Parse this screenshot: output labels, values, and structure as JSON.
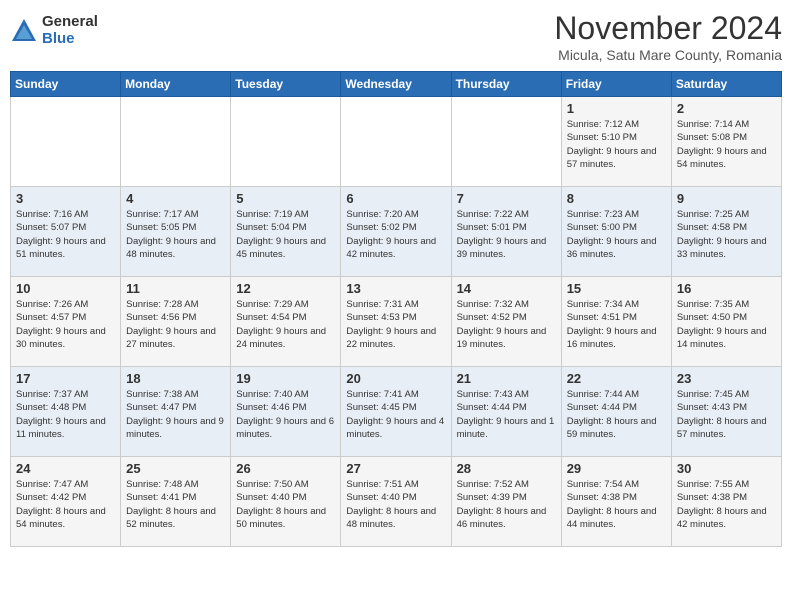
{
  "logo": {
    "general": "General",
    "blue": "Blue"
  },
  "header": {
    "month": "November 2024",
    "location": "Micula, Satu Mare County, Romania"
  },
  "weekdays": [
    "Sunday",
    "Monday",
    "Tuesday",
    "Wednesday",
    "Thursday",
    "Friday",
    "Saturday"
  ],
  "weeks": [
    [
      {
        "day": "",
        "info": ""
      },
      {
        "day": "",
        "info": ""
      },
      {
        "day": "",
        "info": ""
      },
      {
        "day": "",
        "info": ""
      },
      {
        "day": "",
        "info": ""
      },
      {
        "day": "1",
        "info": "Sunrise: 7:12 AM\nSunset: 5:10 PM\nDaylight: 9 hours and 57 minutes."
      },
      {
        "day": "2",
        "info": "Sunrise: 7:14 AM\nSunset: 5:08 PM\nDaylight: 9 hours and 54 minutes."
      }
    ],
    [
      {
        "day": "3",
        "info": "Sunrise: 7:16 AM\nSunset: 5:07 PM\nDaylight: 9 hours and 51 minutes."
      },
      {
        "day": "4",
        "info": "Sunrise: 7:17 AM\nSunset: 5:05 PM\nDaylight: 9 hours and 48 minutes."
      },
      {
        "day": "5",
        "info": "Sunrise: 7:19 AM\nSunset: 5:04 PM\nDaylight: 9 hours and 45 minutes."
      },
      {
        "day": "6",
        "info": "Sunrise: 7:20 AM\nSunset: 5:02 PM\nDaylight: 9 hours and 42 minutes."
      },
      {
        "day": "7",
        "info": "Sunrise: 7:22 AM\nSunset: 5:01 PM\nDaylight: 9 hours and 39 minutes."
      },
      {
        "day": "8",
        "info": "Sunrise: 7:23 AM\nSunset: 5:00 PM\nDaylight: 9 hours and 36 minutes."
      },
      {
        "day": "9",
        "info": "Sunrise: 7:25 AM\nSunset: 4:58 PM\nDaylight: 9 hours and 33 minutes."
      }
    ],
    [
      {
        "day": "10",
        "info": "Sunrise: 7:26 AM\nSunset: 4:57 PM\nDaylight: 9 hours and 30 minutes."
      },
      {
        "day": "11",
        "info": "Sunrise: 7:28 AM\nSunset: 4:56 PM\nDaylight: 9 hours and 27 minutes."
      },
      {
        "day": "12",
        "info": "Sunrise: 7:29 AM\nSunset: 4:54 PM\nDaylight: 9 hours and 24 minutes."
      },
      {
        "day": "13",
        "info": "Sunrise: 7:31 AM\nSunset: 4:53 PM\nDaylight: 9 hours and 22 minutes."
      },
      {
        "day": "14",
        "info": "Sunrise: 7:32 AM\nSunset: 4:52 PM\nDaylight: 9 hours and 19 minutes."
      },
      {
        "day": "15",
        "info": "Sunrise: 7:34 AM\nSunset: 4:51 PM\nDaylight: 9 hours and 16 minutes."
      },
      {
        "day": "16",
        "info": "Sunrise: 7:35 AM\nSunset: 4:50 PM\nDaylight: 9 hours and 14 minutes."
      }
    ],
    [
      {
        "day": "17",
        "info": "Sunrise: 7:37 AM\nSunset: 4:48 PM\nDaylight: 9 hours and 11 minutes."
      },
      {
        "day": "18",
        "info": "Sunrise: 7:38 AM\nSunset: 4:47 PM\nDaylight: 9 hours and 9 minutes."
      },
      {
        "day": "19",
        "info": "Sunrise: 7:40 AM\nSunset: 4:46 PM\nDaylight: 9 hours and 6 minutes."
      },
      {
        "day": "20",
        "info": "Sunrise: 7:41 AM\nSunset: 4:45 PM\nDaylight: 9 hours and 4 minutes."
      },
      {
        "day": "21",
        "info": "Sunrise: 7:43 AM\nSunset: 4:44 PM\nDaylight: 9 hours and 1 minute."
      },
      {
        "day": "22",
        "info": "Sunrise: 7:44 AM\nSunset: 4:44 PM\nDaylight: 8 hours and 59 minutes."
      },
      {
        "day": "23",
        "info": "Sunrise: 7:45 AM\nSunset: 4:43 PM\nDaylight: 8 hours and 57 minutes."
      }
    ],
    [
      {
        "day": "24",
        "info": "Sunrise: 7:47 AM\nSunset: 4:42 PM\nDaylight: 8 hours and 54 minutes."
      },
      {
        "day": "25",
        "info": "Sunrise: 7:48 AM\nSunset: 4:41 PM\nDaylight: 8 hours and 52 minutes."
      },
      {
        "day": "26",
        "info": "Sunrise: 7:50 AM\nSunset: 4:40 PM\nDaylight: 8 hours and 50 minutes."
      },
      {
        "day": "27",
        "info": "Sunrise: 7:51 AM\nSunset: 4:40 PM\nDaylight: 8 hours and 48 minutes."
      },
      {
        "day": "28",
        "info": "Sunrise: 7:52 AM\nSunset: 4:39 PM\nDaylight: 8 hours and 46 minutes."
      },
      {
        "day": "29",
        "info": "Sunrise: 7:54 AM\nSunset: 4:38 PM\nDaylight: 8 hours and 44 minutes."
      },
      {
        "day": "30",
        "info": "Sunrise: 7:55 AM\nSunset: 4:38 PM\nDaylight: 8 hours and 42 minutes."
      }
    ]
  ]
}
